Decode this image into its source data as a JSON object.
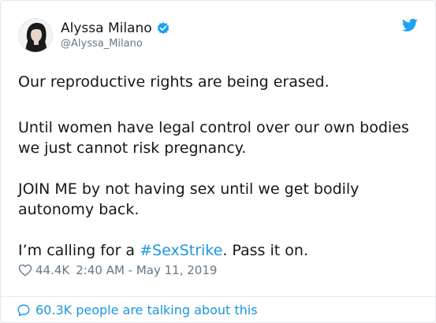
{
  "tweet": {
    "author": {
      "display_name": "Alyssa Milano",
      "handle": "@Alyssa_Milano"
    },
    "paragraphs": {
      "p1": "Our reproductive rights are being erased.",
      "p2": "Until women have legal control over our own bodies we just cannot risk pregnancy.",
      "p3": "JOIN ME by not having sex until we get bodily autonomy back.",
      "p4_prefix": "I’m calling for a ",
      "p4_hashtag": "#SexStrike",
      "p4_suffix": ". Pass it on."
    },
    "meta": {
      "likes": "44.4K",
      "timestamp": "2:40 AM - May 11, 2019"
    },
    "footer": {
      "talking": "60.3K people are talking about this"
    }
  },
  "icons": {
    "verified": "verified-badge-icon",
    "bird": "twitter-bird-icon",
    "heart": "heart-icon",
    "bubble": "reply-bubble-icon"
  },
  "colors": {
    "link": "#1b95e0",
    "muted": "#657786",
    "text": "#14171a"
  }
}
